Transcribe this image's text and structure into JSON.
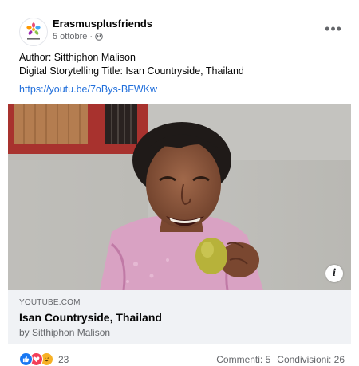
{
  "post": {
    "page_name": "Erasmusplusfriends",
    "date": "5 ottobre",
    "separator": "·",
    "more_label": "•••",
    "text_lines": [
      "Author: Sitthiphon Malison",
      "Digital Storytelling Title: Isan Countryside, Thailand"
    ],
    "link_text": "https://youtu.be/7oBys-BFWKw"
  },
  "media": {
    "info_label": "i"
  },
  "preview": {
    "domain": "YOUTUBE.COM",
    "title": "Isan Countryside, Thailand",
    "subtitle": "by Sitthiphon Malison"
  },
  "footer": {
    "reaction_count": "23",
    "comments": "Commenti: 5",
    "shares": "Condivisioni: 26"
  },
  "colors": {
    "link": "#216fdb",
    "secondary_text": "#65676b",
    "like": "#1877f2",
    "love": "#f33e58",
    "haha": "#f7b125"
  },
  "icons": [
    "erasmus-logo-icon",
    "globe-icon",
    "more-icon",
    "info-icon",
    "like-reaction-icon",
    "love-reaction-icon",
    "haha-reaction-icon"
  ]
}
